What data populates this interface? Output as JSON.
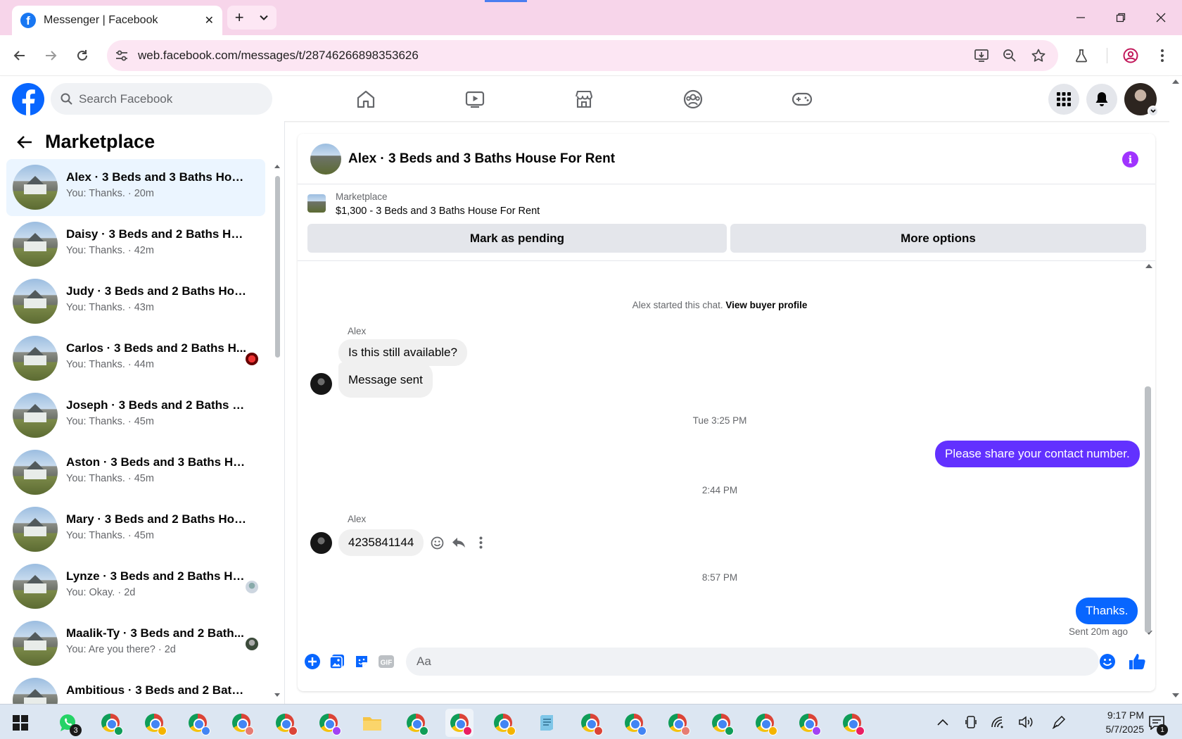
{
  "browser": {
    "tab_title": "Messenger | Facebook",
    "url": "web.facebook.com/messages/t/28746266898353626"
  },
  "fb_header": {
    "search_placeholder": "Search Facebook"
  },
  "sidebar": {
    "title": "Marketplace",
    "conversations": [
      {
        "name": "Alex · 3 Beds and 3 Baths House...",
        "preview": "You: Thanks. · 20m",
        "active": true
      },
      {
        "name": "Daisy · 3 Beds and 2 Baths Hous...",
        "preview": "You: Thanks. · 42m"
      },
      {
        "name": "Judy · 3 Beds and 2 Baths Hous...",
        "preview": "You: Thanks. · 43m"
      },
      {
        "name": "Carlos · 3 Beds and 2 Baths H...",
        "preview": "You: Thanks. · 44m"
      },
      {
        "name": "Joseph · 3 Beds and 2 Baths Ho...",
        "preview": "You: Thanks. · 45m"
      },
      {
        "name": "Aston · 3 Beds and 3 Baths Hou...",
        "preview": "You: Thanks. · 45m"
      },
      {
        "name": "Mary · 3 Beds and 2 Baths Hous...",
        "preview": "You: Thanks. · 45m"
      },
      {
        "name": "Lynze · 3 Beds and 2 Baths Ho...",
        "preview": "You: Okay. · 2d"
      },
      {
        "name": "Maalik-Ty · 3 Beds and 2 Bath...",
        "preview": "You: Are you there? · 2d"
      },
      {
        "name": "Ambitious · 3 Beds and 2 Baths ...",
        "preview": ""
      }
    ]
  },
  "chat": {
    "title": "Alex · 3 Beds and 3 Baths House For Rent",
    "listing_category": "Marketplace",
    "listing_price": "$1,300 - 3 Beds and 3 Baths House For Rent",
    "mark_pending_label": "Mark as pending",
    "more_options_label": "More options",
    "started_text": "Alex started this chat.",
    "view_profile_label": "View buyer profile",
    "messages": {
      "sender1": "Alex",
      "m1": "Is this still available?",
      "m2": "Message sent",
      "time1": "Tue 3:25 PM",
      "m3": "Please share your contact number.",
      "time2": "2:44 PM",
      "sender2": "Alex",
      "m4": "4235841144",
      "time3": "8:57 PM",
      "m5": "Thanks.",
      "sent_note": "Sent 20m ago"
    },
    "composer_placeholder": "Aa"
  },
  "taskbar": {
    "time": "9:17 PM",
    "date": "5/7/2025",
    "whatsapp_badge": "3",
    "notif_count": "1"
  },
  "colors": {
    "fb_blue": "#0866ff",
    "outgoing_purple": "#6231ff",
    "info_purple": "#a033ff",
    "active_conv_bg": "#ebf5ff",
    "tabstrip_pink": "#f7d5ea"
  }
}
